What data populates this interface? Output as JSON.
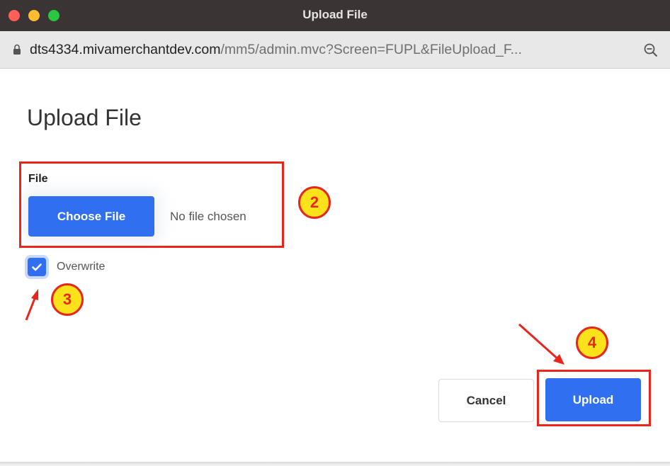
{
  "window": {
    "title": "Upload File"
  },
  "browser": {
    "url_host": "dts4334.mivamerchantdev.com",
    "url_path": "/mm5/admin.mvc?Screen=FUPL&FileUpload_F..."
  },
  "dialog": {
    "heading": "Upload File",
    "file_label": "File",
    "choose_file_label": "Choose File",
    "no_file_text": "No file chosen",
    "overwrite_label": "Overwrite",
    "overwrite_checked": true,
    "cancel_label": "Cancel",
    "upload_label": "Upload"
  },
  "annotations": {
    "step2": "2",
    "step3": "3",
    "step4": "4"
  },
  "colors": {
    "accent": "#2f6ff0",
    "annotation_red": "#e8261c",
    "annotation_yellow": "#fbe21a",
    "titlebar": "#3a3534"
  }
}
